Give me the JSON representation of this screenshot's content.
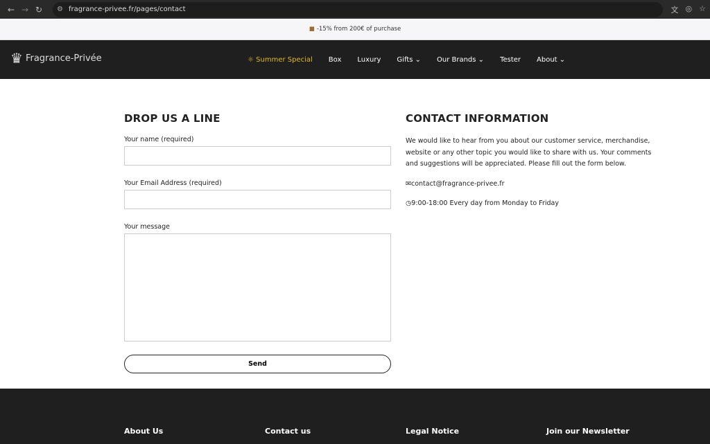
{
  "browser": {
    "url": "fragrance-privee.fr/pages/contact"
  },
  "promo": {
    "text": "-15% from 200€ of purchase"
  },
  "nav": {
    "logo": "Fragrance-Privée",
    "items": [
      {
        "label": "Summer Special"
      },
      {
        "label": "Box"
      },
      {
        "label": "Luxury"
      },
      {
        "label": "Gifts",
        "dropdown": true
      },
      {
        "label": "Our Brands",
        "dropdown": true
      },
      {
        "label": "Tester"
      },
      {
        "label": "About",
        "dropdown": true
      }
    ],
    "accent": "#e2b822"
  },
  "form": {
    "title": "DROP US A LINE",
    "name_label": "Your name (required)",
    "email_label": "Your Email Address (required)",
    "message_label": "Your message",
    "send": "Send"
  },
  "contact": {
    "title": "CONTACT INFORMATION",
    "text": "We would like to hear from you about our customer service, merchandise, website or any other topic you would like to share with us. Your comments and suggestions will be appreciated. Please fill out the form below.",
    "email": "contact@fragrance-privee.fr",
    "hours": "9:00-18:00 Every day from Monday to Friday"
  },
  "footer": {
    "cols": [
      "About Us",
      "Contact us",
      "Legal Notice",
      "Join our Newsletter"
    ]
  }
}
